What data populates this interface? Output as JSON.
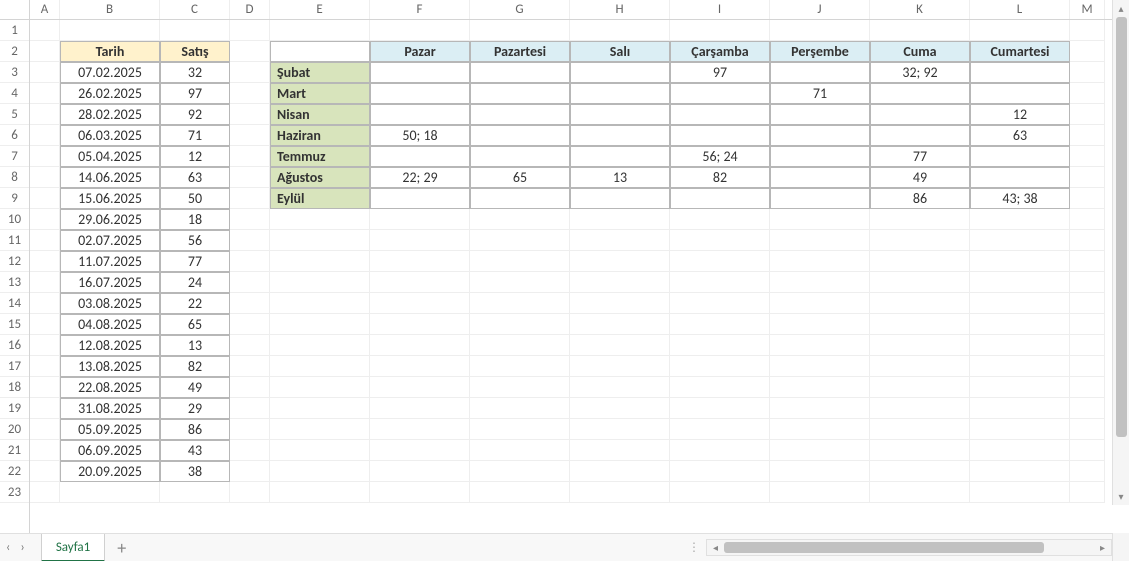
{
  "sheet": {
    "name": "Sayfa1",
    "visible_rows": 23,
    "col_letters": [
      "A",
      "B",
      "C",
      "D",
      "E",
      "F",
      "G",
      "H",
      "I",
      "J",
      "K",
      "L",
      "M"
    ]
  },
  "col_widths": {
    "A": 30,
    "B": 100,
    "C": 70,
    "D": 40,
    "E": 100,
    "F": 100,
    "G": 100,
    "H": 100,
    "I": 100,
    "J": 100,
    "K": 100,
    "L": 100,
    "M": 35
  },
  "table1": {
    "headers": {
      "date": "Tarih",
      "sales": "Satış"
    },
    "rows": [
      {
        "date": "07.02.2025",
        "sales": "32"
      },
      {
        "date": "26.02.2025",
        "sales": "97"
      },
      {
        "date": "28.02.2025",
        "sales": "92"
      },
      {
        "date": "06.03.2025",
        "sales": "71"
      },
      {
        "date": "05.04.2025",
        "sales": "12"
      },
      {
        "date": "14.06.2025",
        "sales": "63"
      },
      {
        "date": "15.06.2025",
        "sales": "50"
      },
      {
        "date": "29.06.2025",
        "sales": "18"
      },
      {
        "date": "02.07.2025",
        "sales": "56"
      },
      {
        "date": "11.07.2025",
        "sales": "77"
      },
      {
        "date": "16.07.2025",
        "sales": "24"
      },
      {
        "date": "03.08.2025",
        "sales": "22"
      },
      {
        "date": "04.08.2025",
        "sales": "65"
      },
      {
        "date": "12.08.2025",
        "sales": "13"
      },
      {
        "date": "13.08.2025",
        "sales": "82"
      },
      {
        "date": "22.08.2025",
        "sales": "49"
      },
      {
        "date": "31.08.2025",
        "sales": "29"
      },
      {
        "date": "05.09.2025",
        "sales": "86"
      },
      {
        "date": "06.09.2025",
        "sales": "43"
      },
      {
        "date": "20.09.2025",
        "sales": "38"
      }
    ]
  },
  "table2": {
    "col_headers": [
      "Pazar",
      "Pazartesi",
      "Salı",
      "Çarşamba",
      "Perşembe",
      "Cuma",
      "Cumartesi"
    ],
    "row_headers": [
      "Şubat",
      "Mart",
      "Nisan",
      "Haziran",
      "Temmuz",
      "Ağustos",
      "Eylül"
    ],
    "grid": [
      [
        "",
        "",
        "",
        "97",
        "",
        "32; 92",
        ""
      ],
      [
        "",
        "",
        "",
        "",
        "71",
        "",
        ""
      ],
      [
        "",
        "",
        "",
        "",
        "",
        "",
        "12"
      ],
      [
        "50; 18",
        "",
        "",
        "",
        "",
        "",
        "63"
      ],
      [
        "",
        "",
        "",
        "56; 24",
        "",
        "77",
        ""
      ],
      [
        "22; 29",
        "65",
        "13",
        "82",
        "",
        "49",
        ""
      ],
      [
        "",
        "",
        "",
        "",
        "",
        "86",
        "43; 38"
      ]
    ]
  }
}
